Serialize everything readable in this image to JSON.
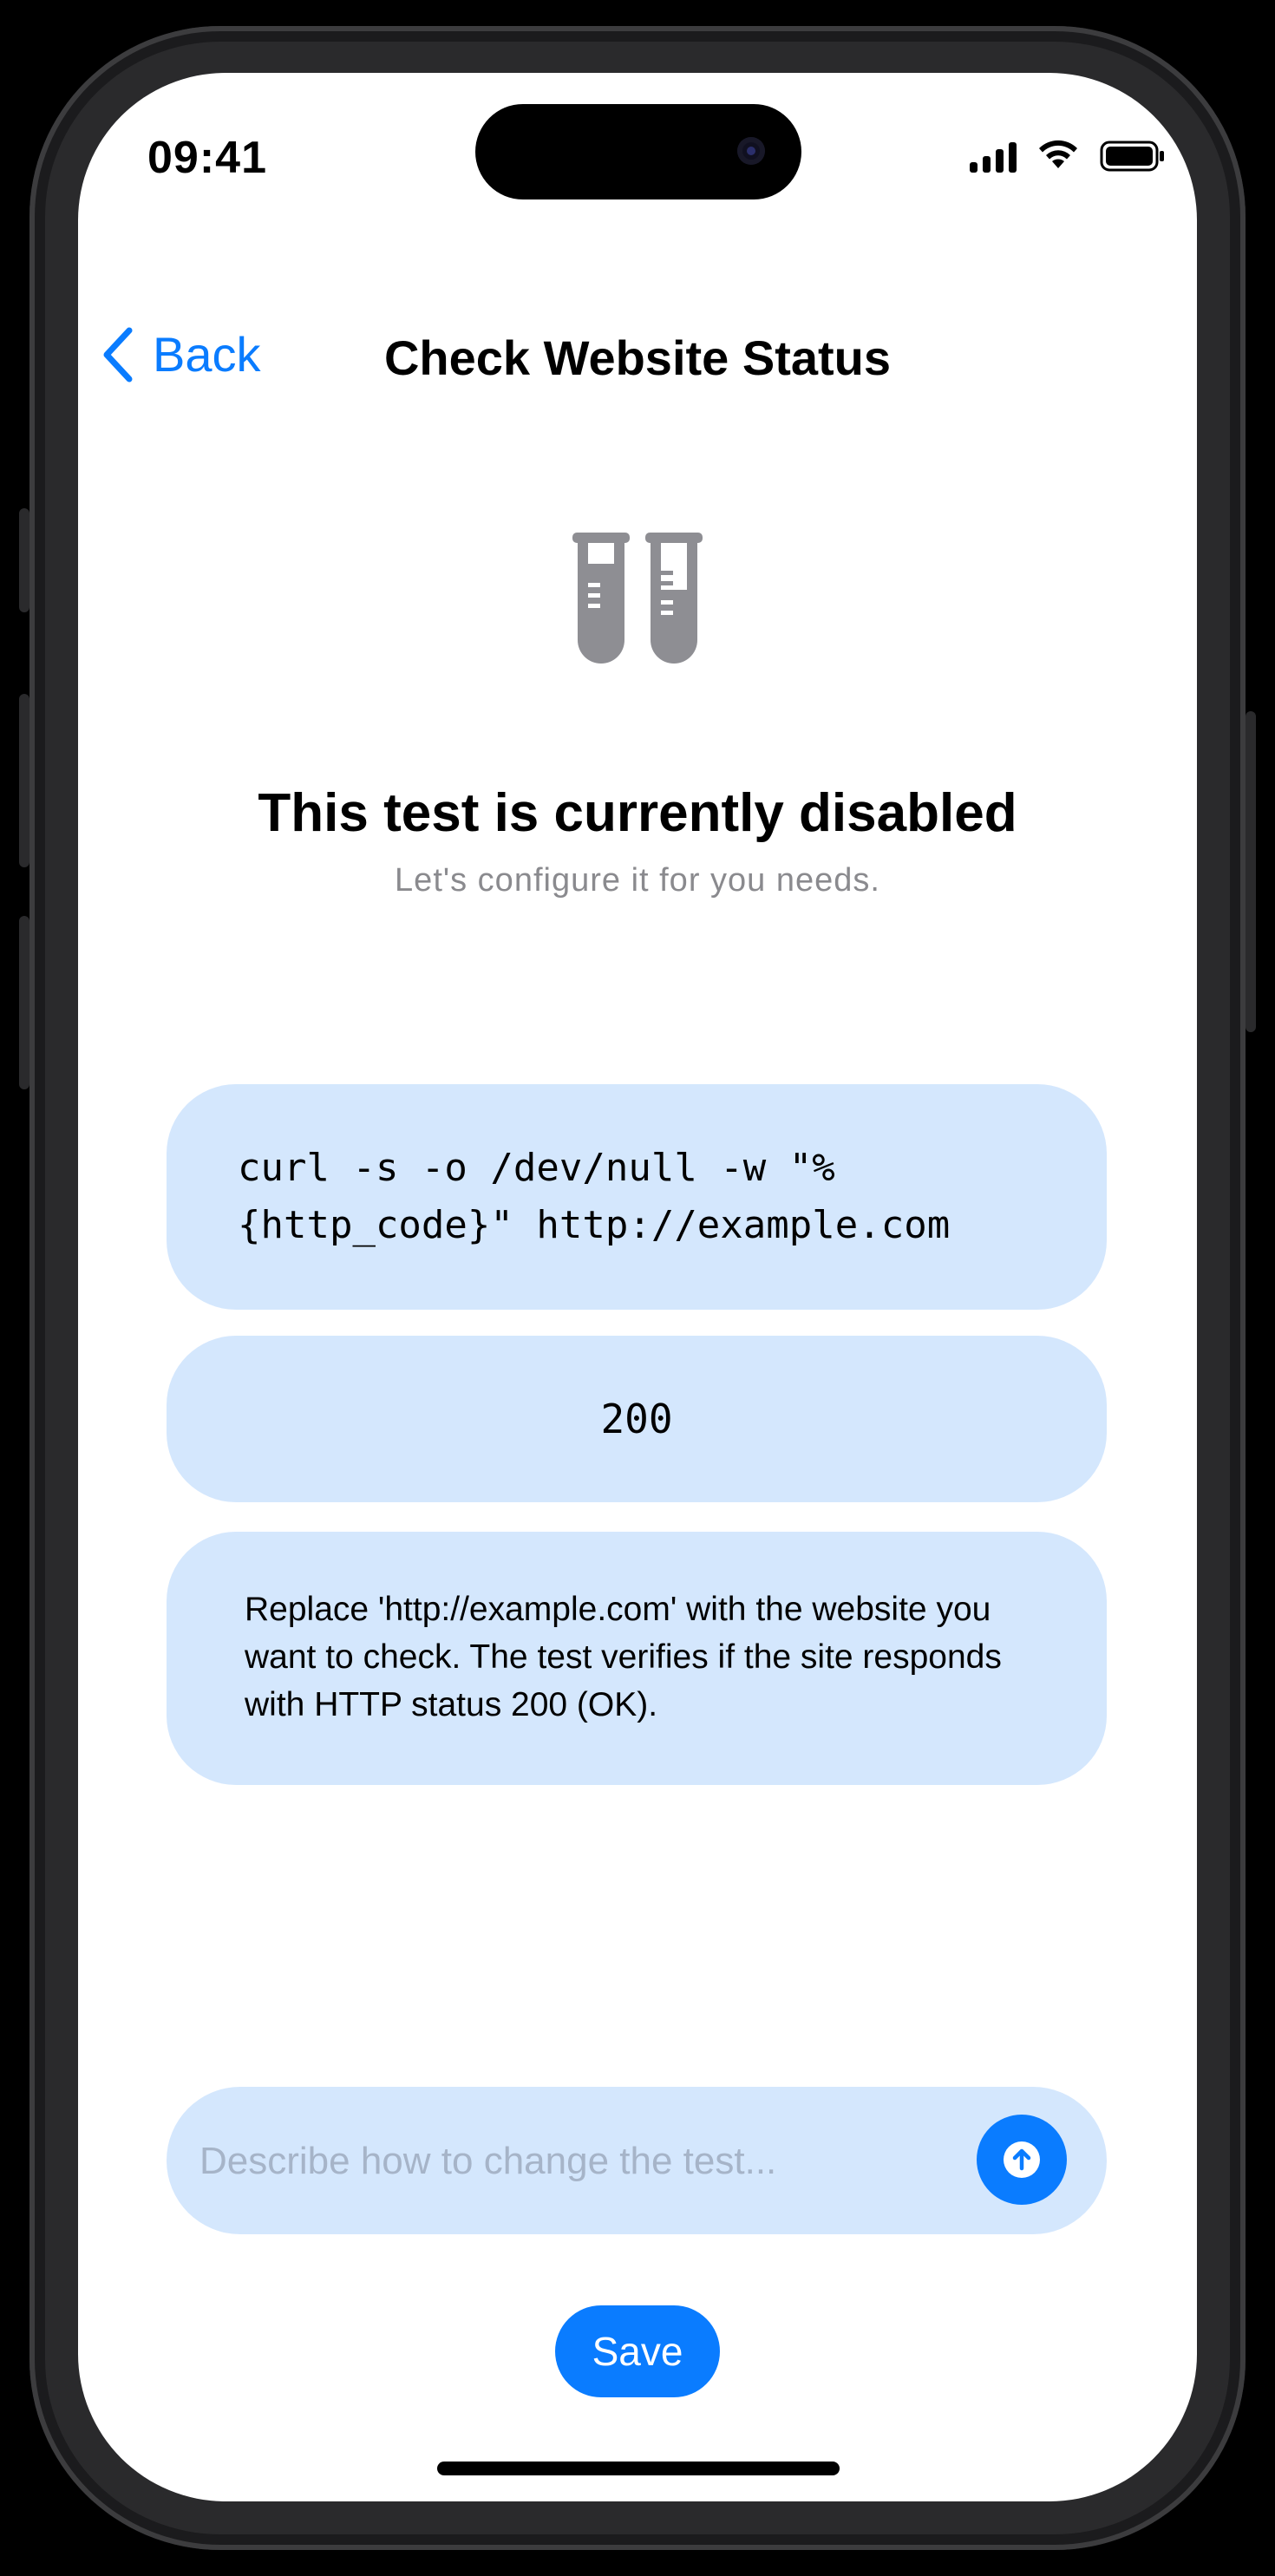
{
  "status_bar": {
    "time": "09:41"
  },
  "nav": {
    "back_label": "Back",
    "title": "Check Website Status"
  },
  "empty_state": {
    "icon": "test-tubes-icon",
    "headline": "This test is currently disabled",
    "subtitle": "Let's configure it for you needs."
  },
  "cards": {
    "command_line1": "curl -s -o /dev/null -w \"%",
    "command_line2": "{http_code}\" http://example.com",
    "expected_result": "200",
    "description": "Replace 'http://example.com' with the website you want to check. The test verifies if the site responds with HTTP status 200 (OK)."
  },
  "composer": {
    "placeholder": "Describe how to change the test...",
    "send_icon": "arrow-up-circle-icon"
  },
  "actions": {
    "save_label": "Save"
  },
  "colors": {
    "accent": "#0a7cff",
    "card_bg": "#d4e7fd",
    "muted_text": "#8a8a8e"
  }
}
